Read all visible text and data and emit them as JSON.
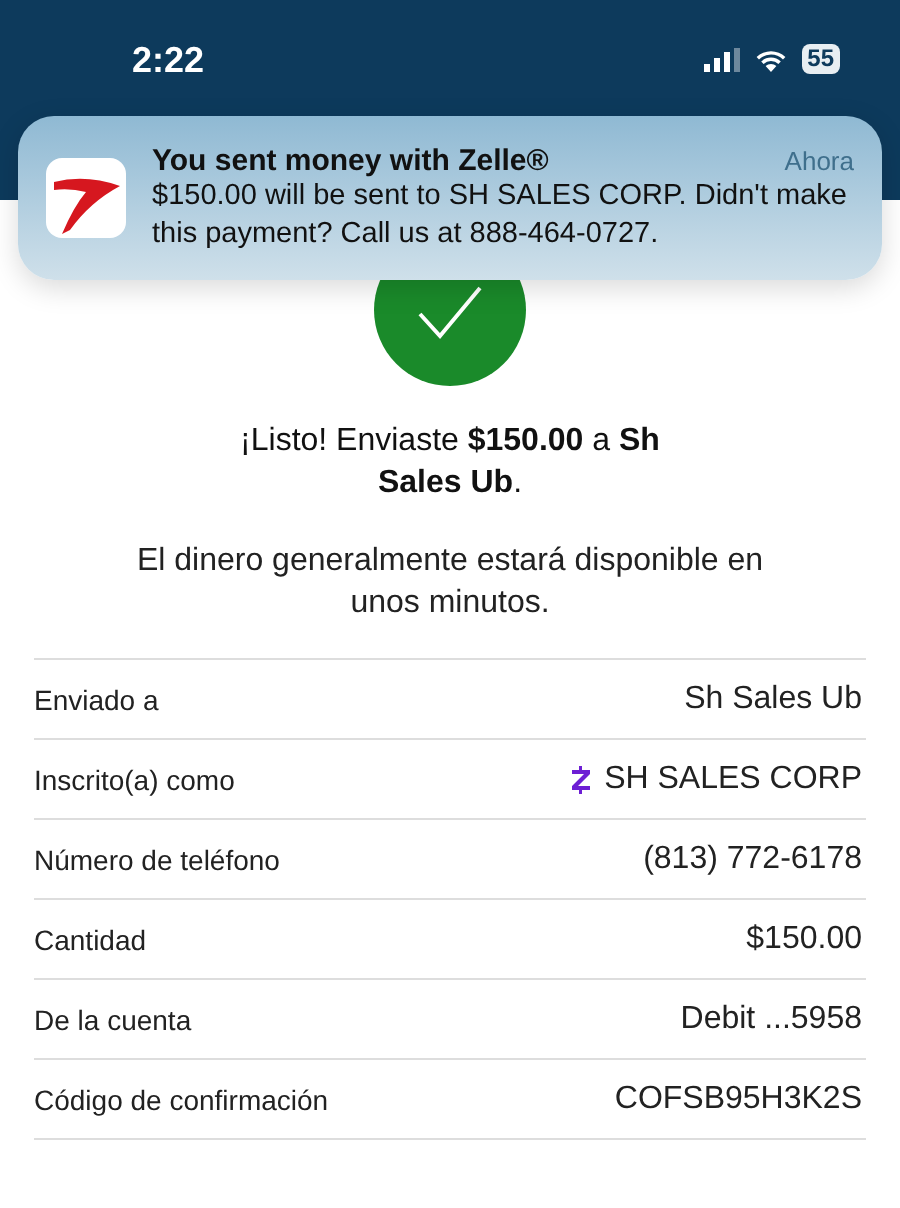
{
  "status_bar": {
    "time": "2:22",
    "battery": "55"
  },
  "notification": {
    "title": "You sent money with Zelle®",
    "time": "Ahora",
    "body": "$150.00 will be sent to SH SALES CORP. Didn't make this payment? Call us at 888-464-0727."
  },
  "success": {
    "headline": "¡Listo! Enviaste **$150.00** a **Sh Sales Ub**.",
    "message": "El dinero generalmente estará disponible en unos minutos."
  },
  "details": [
    {
      "kind": "plain",
      "label": "Enviado a",
      "value": "Sh Sales Ub"
    },
    {
      "kind": "enrolled",
      "label": "Inscrito(a) como",
      "value": "SH SALES CORP"
    },
    {
      "kind": "plain",
      "label": "Número de teléfono",
      "value": "(813) 772-6178"
    },
    {
      "kind": "plain",
      "label": "Cantidad",
      "value": "$150.00"
    },
    {
      "kind": "plain",
      "label": "De la cuenta",
      "value": "Debit ...5958"
    },
    {
      "kind": "plain",
      "label": "Código de confirmación",
      "value": "COFSB95H3K2S"
    }
  ]
}
